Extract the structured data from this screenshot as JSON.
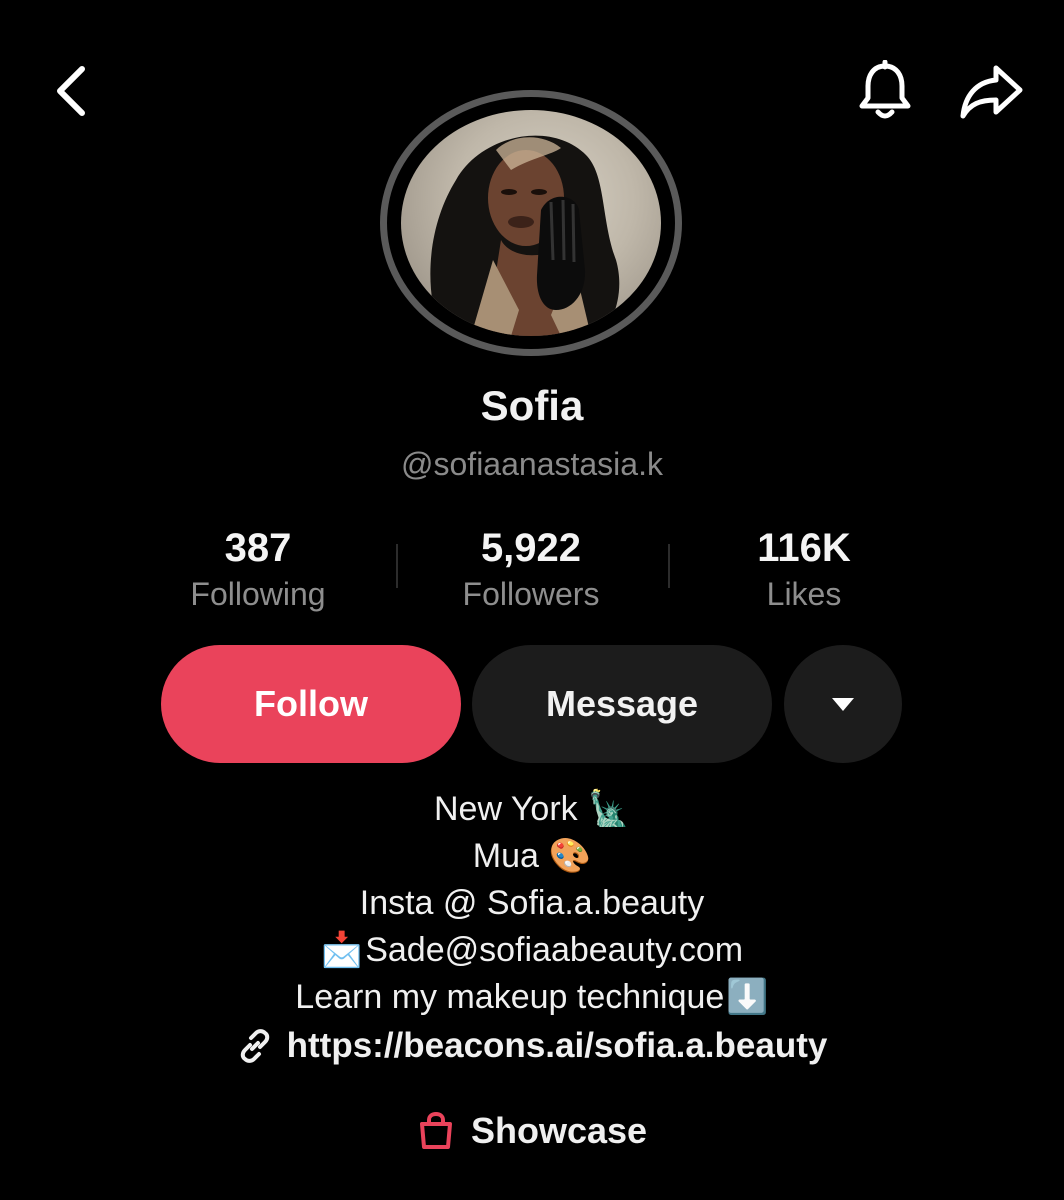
{
  "header": {
    "back_icon": "chevron-left-icon",
    "bell_icon": "bell-icon",
    "share_icon": "share-arrow-icon"
  },
  "profile": {
    "name": "Sofia",
    "handle": "@sofiaanastasia.k"
  },
  "stats": [
    {
      "value": "387",
      "label": "Following"
    },
    {
      "value": "5,922",
      "label": "Followers"
    },
    {
      "value": "116K",
      "label": "Likes"
    }
  ],
  "actions": {
    "follow_label": "Follow",
    "message_label": "Message",
    "more_icon": "caret-down-icon"
  },
  "bio": {
    "line1": "New York",
    "line1_emoji": "🗽",
    "line2": "Mua",
    "line2_emoji": "🎨",
    "line3": "Insta @ Sofia.a.beauty",
    "line4_emoji": "📩",
    "line4": "Sade@sofiaabeauty.com",
    "line5": "Learn my makeup technique",
    "line5_emoji": "⬇️"
  },
  "link": {
    "url": "https://beacons.ai/sofia.a.beauty",
    "icon": "link-icon"
  },
  "showcase": {
    "label": "Showcase",
    "icon": "shopping-bag-icon"
  },
  "colors": {
    "follow_button": "#ea435b",
    "secondary_button": "#1c1c1c",
    "muted_text": "#8a8a8a",
    "showcase_icon": "#ea435b"
  }
}
